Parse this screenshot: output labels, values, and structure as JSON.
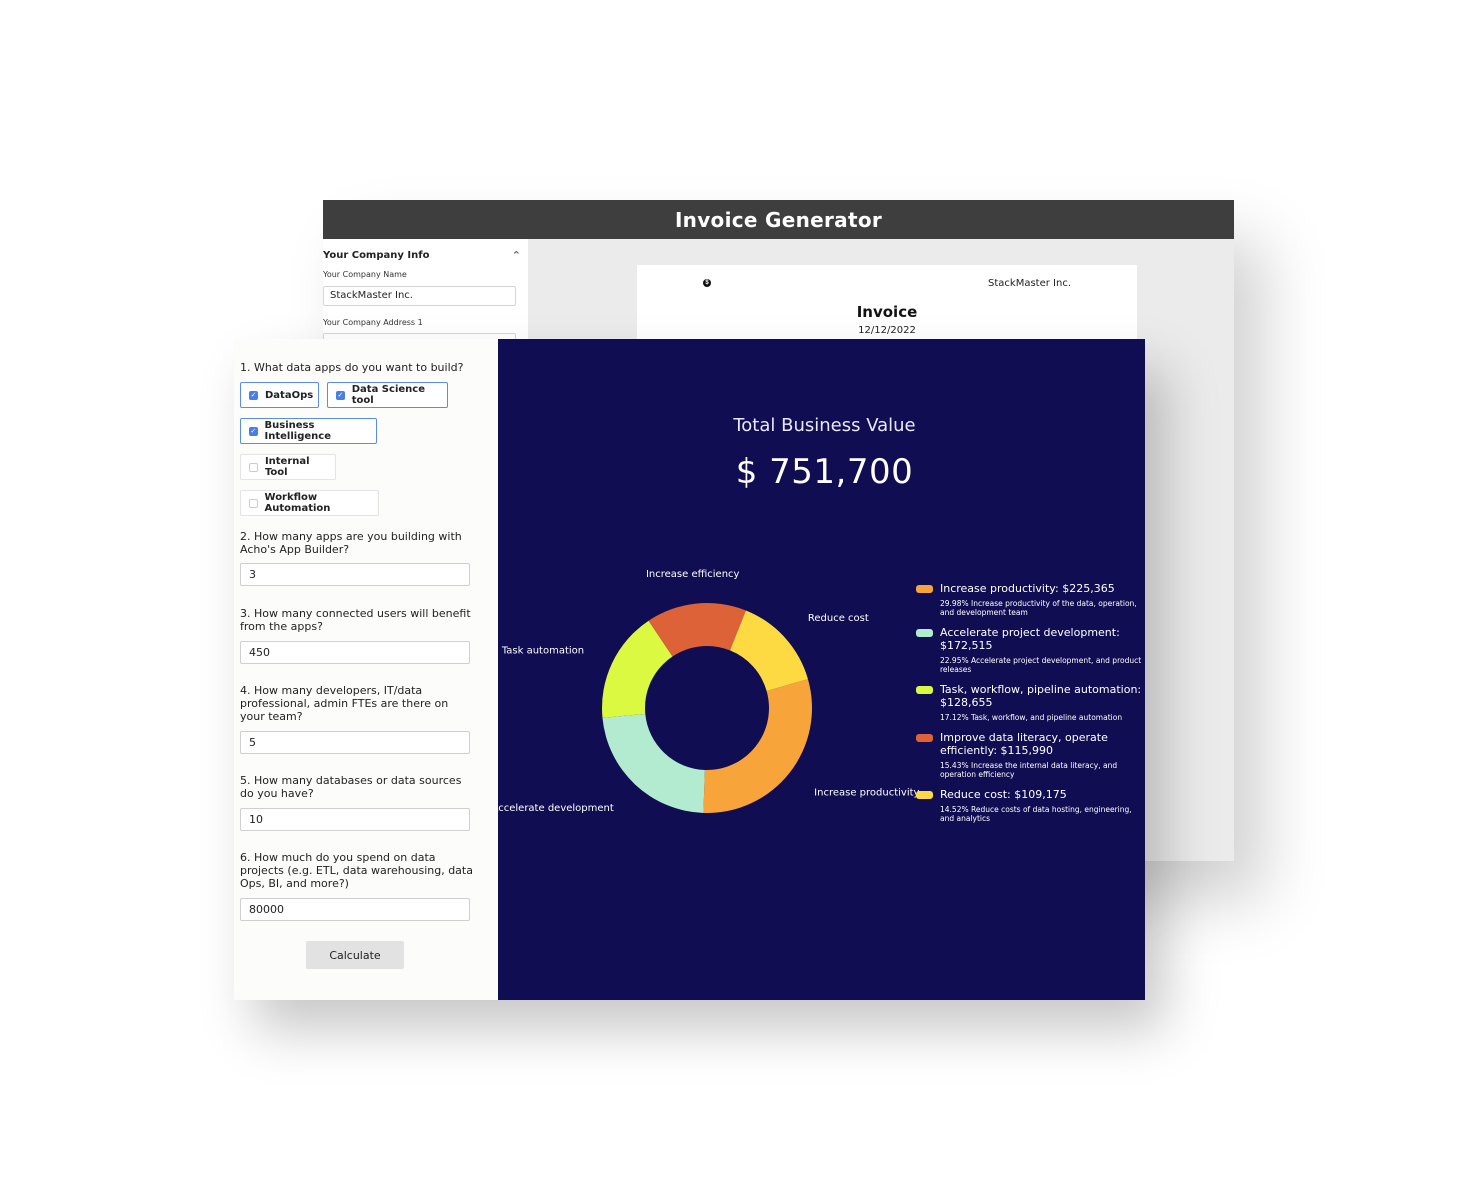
{
  "invoice_app": {
    "title": "Invoice Generator",
    "sidebar": {
      "section_title": "Your Company Info",
      "company_name_label": "Your Company Name",
      "company_name_value": "StackMaster Inc.",
      "company_address_label": "Your Company Address 1"
    },
    "preview": {
      "logo_glyph": "$",
      "company": "StackMaster Inc.",
      "title": "Invoice",
      "date": "12/12/2022"
    }
  },
  "calculator": {
    "q1": "1. What data apps do you want to build?",
    "options": [
      {
        "label": "DataOps",
        "checked": true
      },
      {
        "label": "Data Science tool",
        "checked": true
      },
      {
        "label": "Business Intelligence",
        "checked": true
      },
      {
        "label": "Internal Tool",
        "checked": false
      },
      {
        "label": "Workflow Automation",
        "checked": false
      }
    ],
    "q2": "2. How many apps are you building with Acho's App Builder?",
    "a2": "3",
    "q3": "3. How many connected users will benefit from the apps?",
    "a3": "450",
    "q4": "4. How many developers, IT/data professional, admin FTEs are there on your team?",
    "a4": "5",
    "q5": "5. How many databases or data sources do you have?",
    "a5": "10",
    "q6": "6. How much do you spend on data projects (e.g. ETL, data warehousing, data Ops, BI, and more?)",
    "a6": "80000",
    "calculate_label": "Calculate"
  },
  "results": {
    "label": "Total Business Value",
    "value": "$ 751,700"
  },
  "chart_data": {
    "type": "pie",
    "donut": true,
    "categories": [
      "Increase productivity",
      "Accelerate development",
      "Task automation",
      "Increase efficiency",
      "Reduce cost"
    ],
    "values": [
      225365,
      172515,
      128655,
      115990,
      109175
    ],
    "percentages": [
      29.98,
      22.95,
      17.12,
      15.43,
      14.52
    ],
    "colors": [
      "#f7a53b",
      "#b2ebd0",
      "#dbf941",
      "#dd6237",
      "#fdda41"
    ],
    "legend_position": "right",
    "legend": [
      {
        "title": "Increase productivity: $225,365",
        "desc": "29.98% Increase productivity of the data, operation, and development team"
      },
      {
        "title": "Accelerate project development: $172,515",
        "desc": "22.95% Accelerate project development, and product releases"
      },
      {
        "title": "Task, workflow, pipeline automation: $128,655",
        "desc": "17.12% Task, workflow, and pipeline automation"
      },
      {
        "title": "Improve data literacy, operate efficiently: $115,990",
        "desc": "15.43% Increase the internal data literacy, and operation efficiency"
      },
      {
        "title": "Reduce cost: $109,175",
        "desc": "14.52% Reduce costs of data hosting, engineering, and analytics"
      }
    ]
  }
}
